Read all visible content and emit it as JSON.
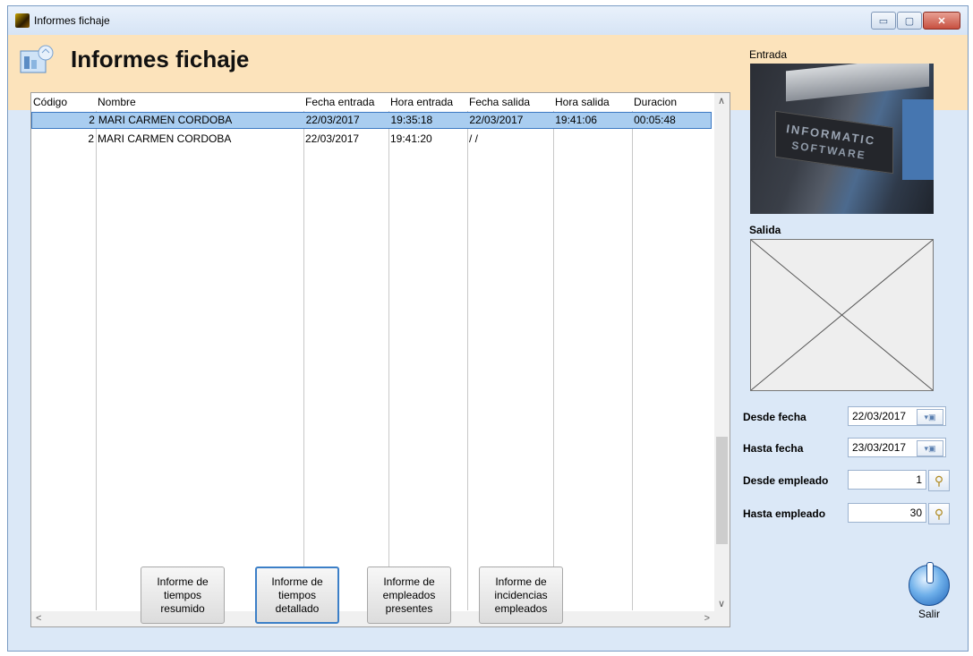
{
  "window": {
    "title": "Informes fichaje",
    "minimize": "▭",
    "maximize": "▢",
    "close": "✕"
  },
  "header": {
    "title": "Informes fichaje"
  },
  "grid": {
    "columns": [
      "Código",
      "Nombre",
      "Fecha entrada",
      "Hora entrada",
      "Fecha salida",
      "Hora salida",
      "Duracion"
    ],
    "rows": [
      {
        "codigo": "2",
        "nombre": "MARI CARMEN CORDOBA",
        "fecha_entrada": "22/03/2017",
        "hora_entrada": "19:35:18",
        "fecha_salida": "22/03/2017",
        "hora_salida": "19:41:06",
        "duracion": "00:05:48",
        "selected": true
      },
      {
        "codigo": "2",
        "nombre": "MARI CARMEN CORDOBA",
        "fecha_entrada": "22/03/2017",
        "hora_entrada": "19:41:20",
        "fecha_salida": "/ /",
        "hora_salida": "",
        "duracion": "",
        "selected": false
      }
    ]
  },
  "photos": {
    "entrada_label": "Entrada",
    "entrada_sign_line1": "INFORMATIC",
    "entrada_sign_line2": "SOFTWARE",
    "salida_label": "Salida"
  },
  "filters": {
    "desde_fecha_label": "Desde fecha",
    "desde_fecha_value": "22/03/2017",
    "hasta_fecha_label": "Hasta fecha",
    "hasta_fecha_value": "23/03/2017",
    "desde_empleado_label": "Desde empleado",
    "desde_empleado_value": "1",
    "hasta_empleado_label": "Hasta empleado",
    "hasta_empleado_value": "30"
  },
  "actions": {
    "resumido": "Informe de\ntiempos\nresumido",
    "detallado": "Informe de\ntiempos\ndetallado",
    "presentes": "Informe de\nempleados\npresentes",
    "incidencias": "Informe de\nincidencias\nempleados",
    "salir": "Salir"
  },
  "colors": {
    "header_band": "#fce3bb",
    "window_bg": "#dbe8f7",
    "selection": "#a9cdf0"
  }
}
